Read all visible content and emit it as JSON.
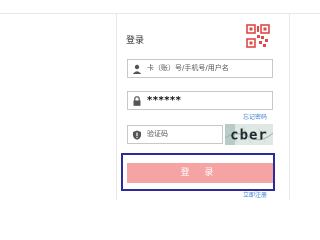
{
  "login": {
    "title": "登录",
    "username": {
      "placeholder": "卡（账）号/手机号/用户名"
    },
    "password": {
      "value": "******"
    },
    "forgot_link": "忘记密码",
    "captcha": {
      "placeholder": "验证码",
      "image_text": "cber"
    },
    "login_button": "登 录",
    "register_link": "立即注册"
  },
  "colors": {
    "login_button_bg": "#f6a3a3",
    "link": "#3a7fd5",
    "highlight_border": "#2b2b9e",
    "qr_icon": "#e04848"
  },
  "icons": {
    "qr": "qr-code-icon",
    "user": "user-icon",
    "lock": "lock-icon",
    "shield": "shield-icon"
  }
}
